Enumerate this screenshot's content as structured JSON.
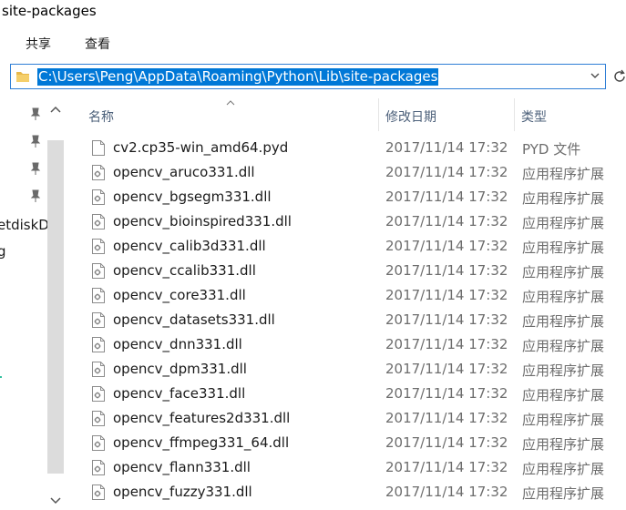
{
  "window": {
    "title": "site-packages"
  },
  "ribbon": {
    "tabs": [
      "共享",
      "查看"
    ]
  },
  "address_bar": {
    "path": "C:\\Users\\Peng\\AppData\\Roaming\\Python\\Lib\\site-packages"
  },
  "nav_pane": {
    "items": [
      "etdiskDo",
      "g"
    ]
  },
  "columns": {
    "name": "名称",
    "date": "修改日期",
    "type": "类型"
  },
  "files": [
    {
      "name": "cv2.cp35-win_amd64.pyd",
      "date": "2017/11/14 17:32",
      "type": "PYD 文件"
    },
    {
      "name": "opencv_aruco331.dll",
      "date": "2017/11/14 17:32",
      "type": "应用程序扩展"
    },
    {
      "name": "opencv_bgsegm331.dll",
      "date": "2017/11/14 17:32",
      "type": "应用程序扩展"
    },
    {
      "name": "opencv_bioinspired331.dll",
      "date": "2017/11/14 17:32",
      "type": "应用程序扩展"
    },
    {
      "name": "opencv_calib3d331.dll",
      "date": "2017/11/14 17:32",
      "type": "应用程序扩展"
    },
    {
      "name": "opencv_ccalib331.dll",
      "date": "2017/11/14 17:32",
      "type": "应用程序扩展"
    },
    {
      "name": "opencv_core331.dll",
      "date": "2017/11/14 17:32",
      "type": "应用程序扩展"
    },
    {
      "name": "opencv_datasets331.dll",
      "date": "2017/11/14 17:32",
      "type": "应用程序扩展"
    },
    {
      "name": "opencv_dnn331.dll",
      "date": "2017/11/14 17:32",
      "type": "应用程序扩展"
    },
    {
      "name": "opencv_dpm331.dll",
      "date": "2017/11/14 17:32",
      "type": "应用程序扩展"
    },
    {
      "name": "opencv_face331.dll",
      "date": "2017/11/14 17:32",
      "type": "应用程序扩展"
    },
    {
      "name": "opencv_features2d331.dll",
      "date": "2017/11/14 17:32",
      "type": "应用程序扩展"
    },
    {
      "name": "opencv_ffmpeg331_64.dll",
      "date": "2017/11/14 17:32",
      "type": "应用程序扩展"
    },
    {
      "name": "opencv_flann331.dll",
      "date": "2017/11/14 17:32",
      "type": "应用程序扩展"
    },
    {
      "name": "opencv_fuzzy331.dll",
      "date": "2017/11/14 17:32",
      "type": "应用程序扩展"
    }
  ],
  "colors": {
    "selection": "#0078d7",
    "focus_border": "#2f7fd6",
    "header_text": "#4c607a",
    "secondary_text": "#6d6d6d",
    "scroll_track": "#dcdcdc"
  },
  "icons": {
    "folder": "folder-icon",
    "pin": "pin-icon",
    "file": "file-icon",
    "dll": "dll-file-icon",
    "refresh": "refresh-icon",
    "dropdown": "chevron-down-icon"
  }
}
